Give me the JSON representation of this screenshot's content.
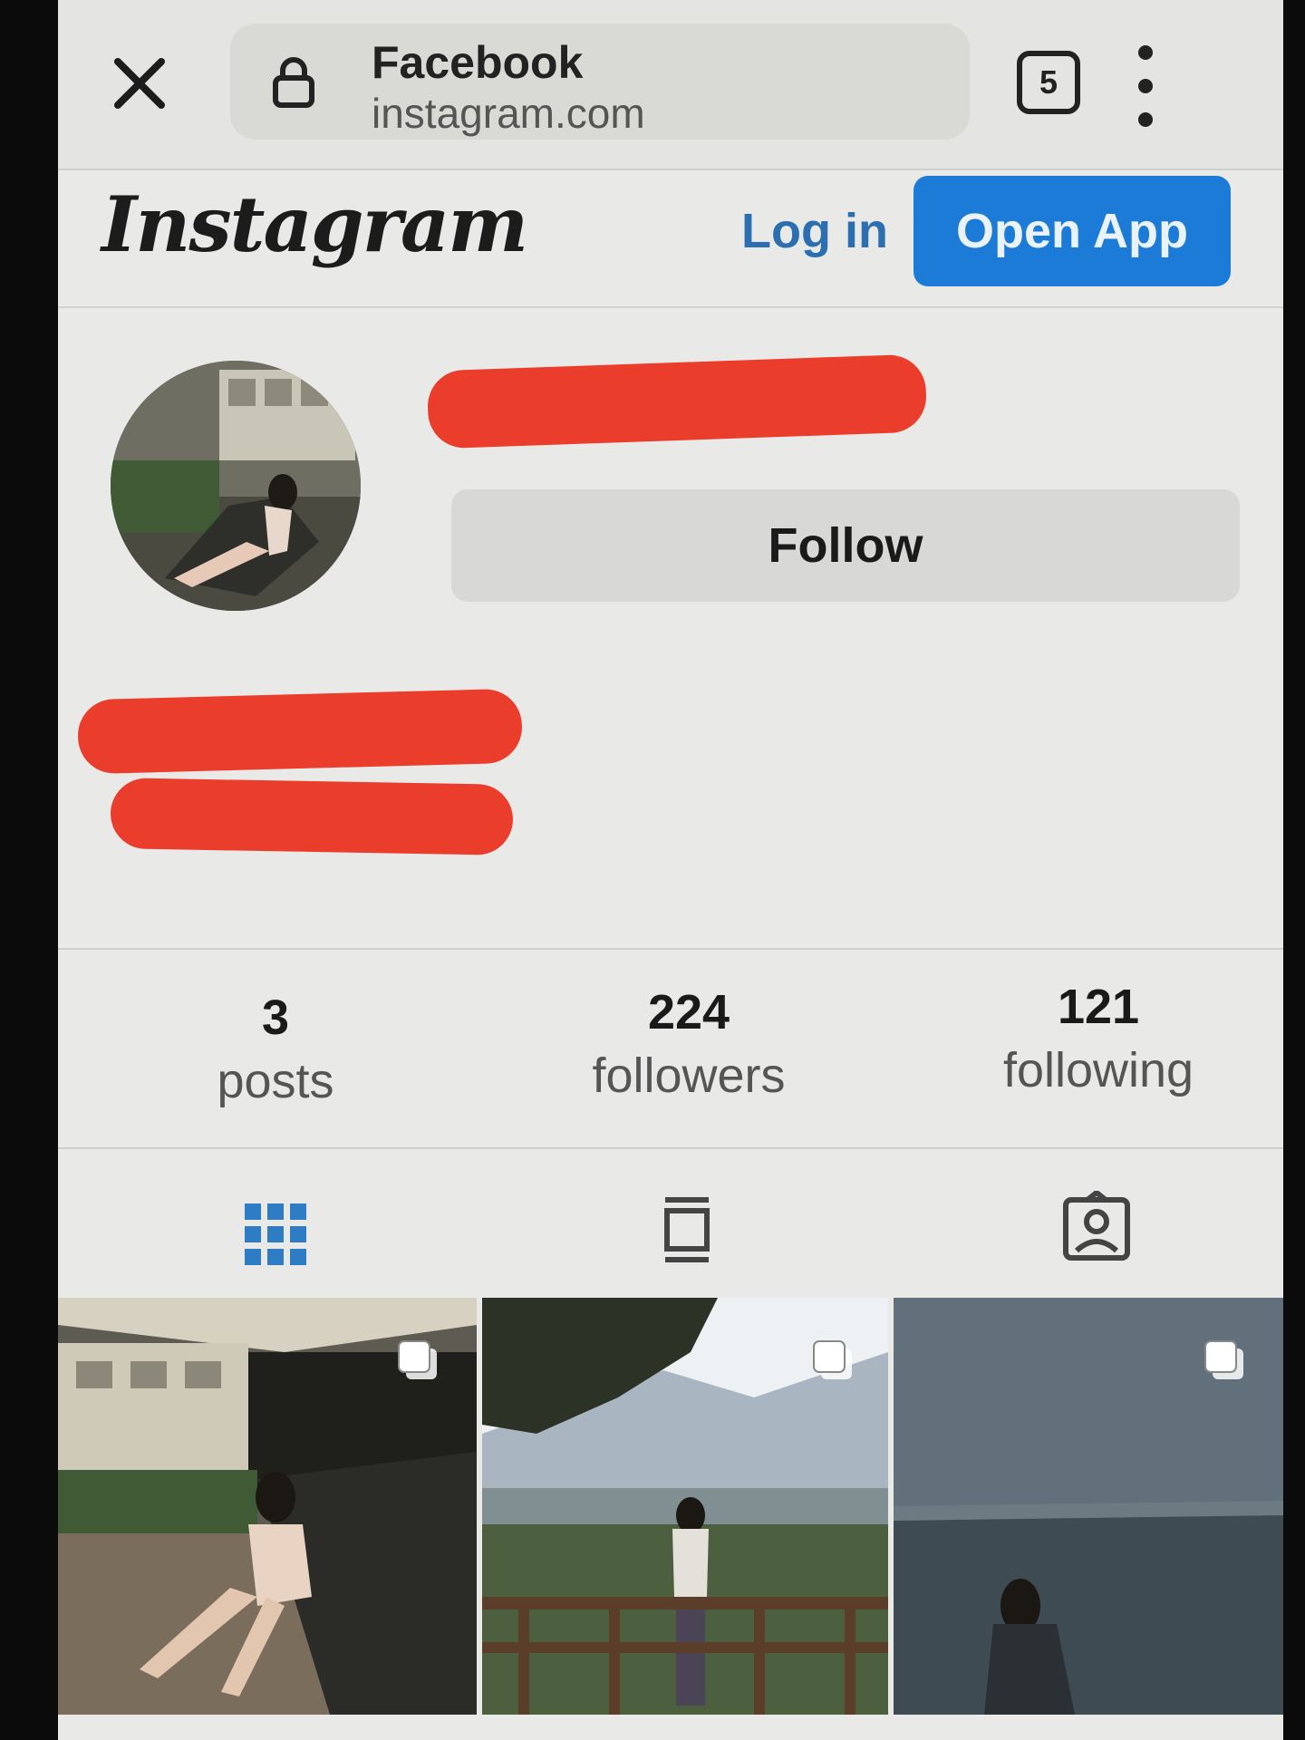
{
  "browser": {
    "site_title": "Facebook",
    "site_url": "instagram.com",
    "tab_count": "5",
    "icons": {
      "close": "close-icon",
      "lock": "lock-icon",
      "menu": "more-vertical-icon"
    }
  },
  "header": {
    "logo": "Instagram",
    "login_label": "Log in",
    "open_app_label": "Open App",
    "accent_color": "#1d7bd8"
  },
  "profile": {
    "follow_label": "Follow",
    "stats": [
      {
        "value": "3",
        "label": "posts"
      },
      {
        "value": "224",
        "label": "followers"
      },
      {
        "value": "121",
        "label": "following"
      }
    ]
  },
  "tabs": [
    {
      "icon": "grid-icon",
      "active": true
    },
    {
      "icon": "feed-icon",
      "active": false
    },
    {
      "icon": "tagged-icon",
      "active": false
    }
  ],
  "posts": [
    {
      "icon": "multiple-photos-icon"
    },
    {
      "icon": "multiple-photos-icon"
    },
    {
      "icon": "multiple-photos-icon"
    }
  ]
}
